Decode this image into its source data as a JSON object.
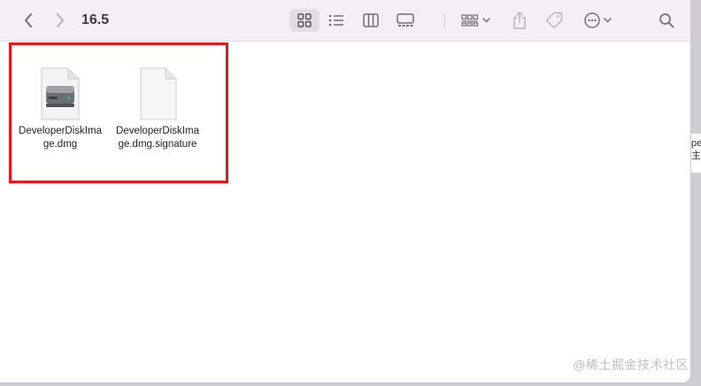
{
  "toolbar": {
    "back_icon": "chevron-left-icon",
    "forward_icon": "chevron-right-icon",
    "title": "16.5",
    "view_buttons": [
      "icon-view-icon",
      "list-view-icon",
      "column-view-icon",
      "gallery-view-icon"
    ],
    "group_icon": "group-icon",
    "share_icon": "share-icon",
    "tag_icon": "tag-icon",
    "more_icon": "more-actions-icon",
    "search_icon": "search-icon",
    "selected_view": "icon-view"
  },
  "files": [
    {
      "name": "DeveloperDiskIma\nge.dmg",
      "icon": "disk-image-icon"
    },
    {
      "name": "DeveloperDiskIma\nge.dmg.signature",
      "icon": "blank-document-icon"
    }
  ],
  "background_window": {
    "text": "pe\n主.w"
  },
  "watermark": "@稀土掘金技术社区",
  "colors": {
    "highlight": "#e0191f",
    "toolbar_bg": "#f4eff5"
  }
}
